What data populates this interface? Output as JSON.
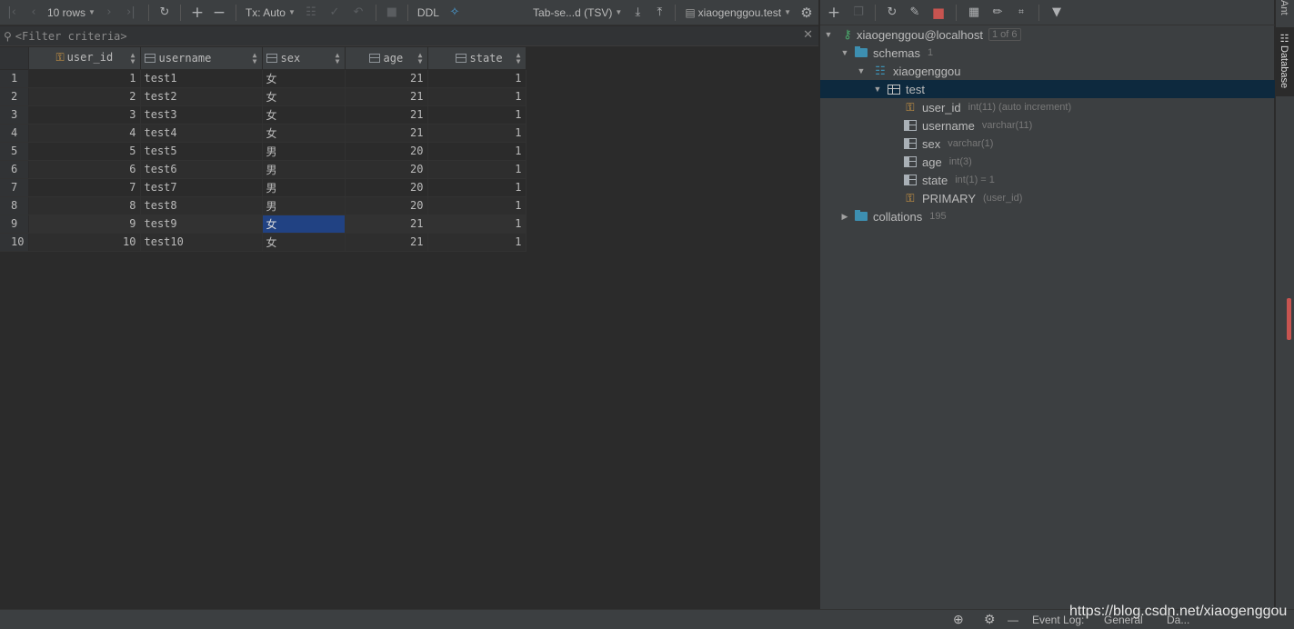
{
  "toolbar": {
    "rows_label": "10 rows",
    "tx_label": "Tx: Auto",
    "ddl_label": "DDL",
    "export_format": "Tab-se...d (TSV)",
    "table_ref": "xiaogenggou.test"
  },
  "filter": {
    "placeholder": "<Filter criteria>"
  },
  "grid": {
    "columns": [
      "user_id",
      "username",
      "sex",
      "age",
      "state"
    ],
    "rows": [
      {
        "n": "1",
        "user_id": "1",
        "username": "test1",
        "sex": "女",
        "age": "21",
        "state": "1"
      },
      {
        "n": "2",
        "user_id": "2",
        "username": "test2",
        "sex": "女",
        "age": "21",
        "state": "1"
      },
      {
        "n": "3",
        "user_id": "3",
        "username": "test3",
        "sex": "女",
        "age": "21",
        "state": "1"
      },
      {
        "n": "4",
        "user_id": "4",
        "username": "test4",
        "sex": "女",
        "age": "21",
        "state": "1"
      },
      {
        "n": "5",
        "user_id": "5",
        "username": "test5",
        "sex": "男",
        "age": "20",
        "state": "1"
      },
      {
        "n": "6",
        "user_id": "6",
        "username": "test6",
        "sex": "男",
        "age": "20",
        "state": "1"
      },
      {
        "n": "7",
        "user_id": "7",
        "username": "test7",
        "sex": "男",
        "age": "20",
        "state": "1"
      },
      {
        "n": "8",
        "user_id": "8",
        "username": "test8",
        "sex": "男",
        "age": "20",
        "state": "1"
      },
      {
        "n": "9",
        "user_id": "9",
        "username": "test9",
        "sex": "女",
        "age": "21",
        "state": "1"
      },
      {
        "n": "10",
        "user_id": "10",
        "username": "test10",
        "sex": "女",
        "age": "21",
        "state": "1"
      }
    ]
  },
  "tree": {
    "connection": "xiaogenggou@localhost",
    "connection_badge": "1 of 6",
    "schemas_label": "schemas",
    "schemas_count": "1",
    "schema_name": "xiaogenggou",
    "table_name": "test",
    "columns": [
      {
        "name": "user_id",
        "type": "int(11) (auto increment)"
      },
      {
        "name": "username",
        "type": "varchar(11)"
      },
      {
        "name": "sex",
        "type": "varchar(1)"
      },
      {
        "name": "age",
        "type": "int(3)"
      },
      {
        "name": "state",
        "type": "int(1) = 1"
      }
    ],
    "key_name": "PRIMARY",
    "key_cols": "(user_id)",
    "collations_label": "collations",
    "collations_count": "195"
  },
  "sidebar": {
    "top_tab": "Ant",
    "database_tab": "Database"
  },
  "status": {
    "event_log": "Event Log:",
    "general": "General",
    "da": "Da..."
  },
  "watermark": "https://blog.csdn.net/xiaogenggou",
  "colors": {
    "selection": "#214283",
    "tree_selection": "#0d293e",
    "folder": "#3d8fb1",
    "key": "#e0a243",
    "stop": "#c75450"
  }
}
